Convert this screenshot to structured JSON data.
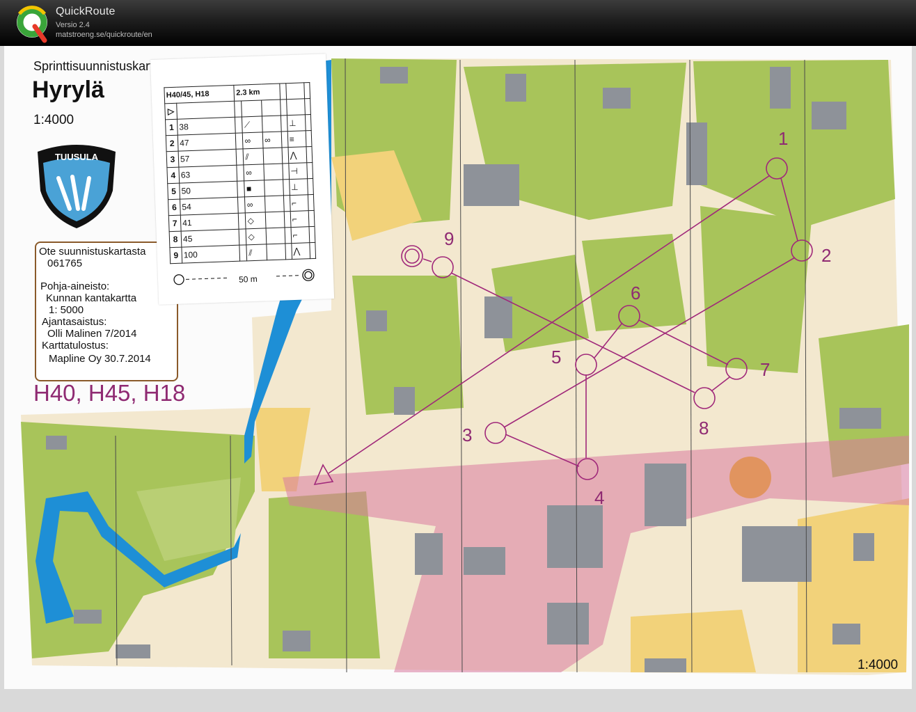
{
  "app": {
    "title": "QuickRoute",
    "version": "Versio 2.4",
    "url": "matstroeng.se/quickroute/en"
  },
  "map": {
    "heading": "Sprinttisuunnistuskartta",
    "place": "Hyrylä",
    "scale": "1:4000",
    "logo_text": "TUUSULA",
    "info": {
      "line1": "Ote suunnistuskartasta",
      "line2": "061765",
      "line3": "Pohja-aineisto:",
      "line4": "Kunnan kantakartta",
      "line5": "1: 5000",
      "line6": "Ajantasaistus:",
      "line7": "Olli Malinen 7/2014",
      "line8": "Karttatulostus:",
      "line9": "Mapline Oy  30.7.2014"
    },
    "classes": "H40, H45, H18",
    "scale_bottom": "1:4000"
  },
  "description_sheet": {
    "class_label": "H40/45, H18",
    "length": "2.3 km",
    "controls": [
      {
        "n": "1",
        "code": "38"
      },
      {
        "n": "2",
        "code": "47"
      },
      {
        "n": "3",
        "code": "57"
      },
      {
        "n": "4",
        "code": "63"
      },
      {
        "n": "5",
        "code": "50"
      },
      {
        "n": "6",
        "code": "54"
      },
      {
        "n": "7",
        "code": "41"
      },
      {
        "n": "8",
        "code": "45"
      },
      {
        "n": "9",
        "code": "100"
      }
    ],
    "finish_distance": "50 m"
  },
  "course_labels": {
    "c1": "1",
    "c2": "2",
    "c3": "3",
    "c4": "4",
    "c5": "5",
    "c6": "6",
    "c7": "7",
    "c8": "8",
    "c9": "9"
  },
  "colors": {
    "course": "#a0287a",
    "forest": "#a8c45a",
    "open": "#f2d27a",
    "paved": "#f3e8cf",
    "building": "#8e9299",
    "water": "#1e8fd6",
    "pedestrian": "#d97aa0"
  }
}
